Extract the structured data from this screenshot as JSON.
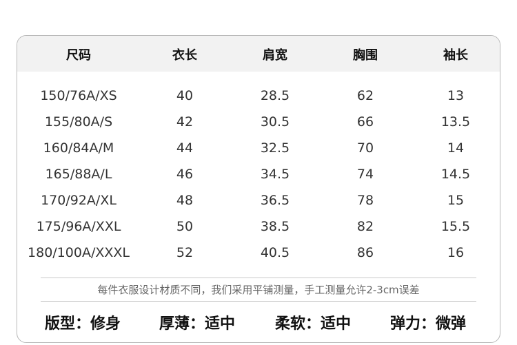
{
  "table": {
    "headers": [
      "尺码",
      "衣长",
      "肩宽",
      "胸围",
      "袖长"
    ],
    "rows": [
      [
        "150/76A/XS",
        "40",
        "28.5",
        "62",
        "13"
      ],
      [
        "155/80A/S",
        "42",
        "30.5",
        "66",
        "13.5"
      ],
      [
        "160/84A/M",
        "44",
        "32.5",
        "70",
        "14"
      ],
      [
        "165/88A/L",
        "46",
        "34.5",
        "74",
        "14.5"
      ],
      [
        "170/92A/XL",
        "48",
        "36.5",
        "78",
        "15"
      ],
      [
        "175/96A/XXL",
        "50",
        "38.5",
        "82",
        "15.5"
      ],
      [
        "180/100A/XXXL",
        "52",
        "40.5",
        "86",
        "16"
      ]
    ]
  },
  "note": "每件衣服设计材质不同，我们采用平铺测量，手工测量允许2-3cm误差",
  "properties": [
    "版型：修身",
    "厚薄：适中",
    "柔软：适中",
    "弹力：微弹"
  ]
}
